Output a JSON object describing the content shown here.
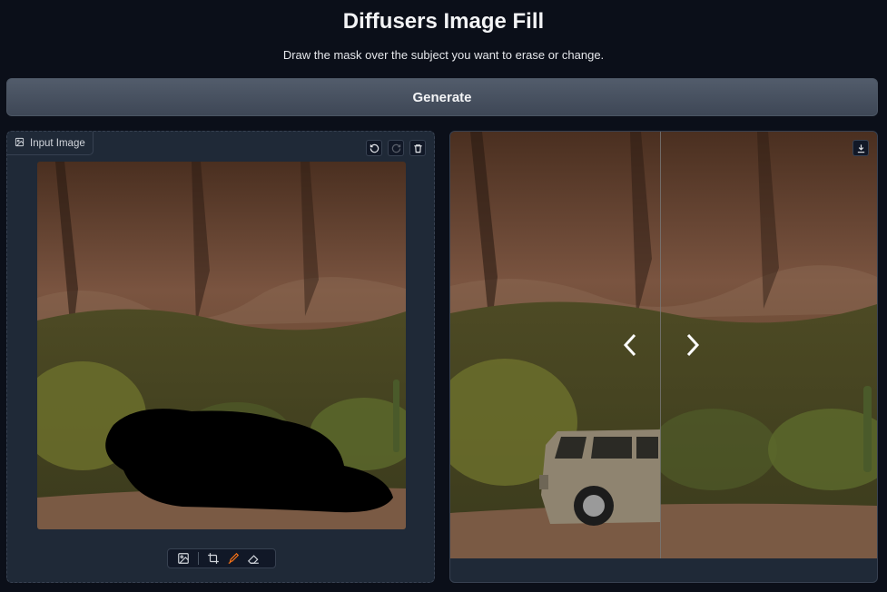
{
  "header": {
    "title": "Diffusers Image Fill",
    "subtitle": "Draw the mask over the subject you want to erase or change."
  },
  "generate_button": {
    "label": "Generate"
  },
  "input_panel": {
    "label": "Input Image",
    "label_icon": "image-icon",
    "actions": [
      "undo-icon",
      "redo-icon",
      "trash-icon"
    ],
    "toolbar": [
      "image-icon",
      "crop-icon",
      "brush-icon",
      "eraser-icon"
    ],
    "active_tool": "brush",
    "accent_color": "#f97316"
  },
  "output_panel": {
    "actions": [
      "download-icon"
    ],
    "slider_position": 0.49,
    "slider_controls": [
      "chevron-left-icon",
      "chevron-right-icon"
    ]
  }
}
